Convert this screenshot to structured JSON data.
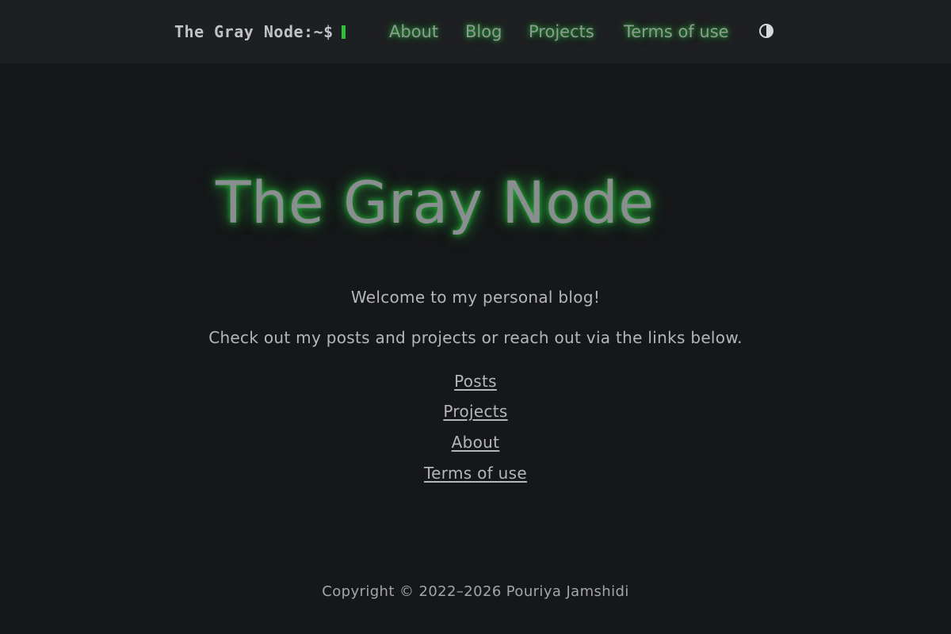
{
  "header": {
    "brand": "The Gray Node:~$",
    "nav": {
      "about": "About",
      "blog": "Blog",
      "projects": "Projects",
      "terms": "Terms of use"
    },
    "theme_toggle_icon": "contrast-half-circle-icon"
  },
  "main": {
    "title": "The Gray Node",
    "welcome": "Welcome to my personal blog!",
    "intro": "Check out my posts and projects or reach out via the links below.",
    "links": {
      "posts": "Posts",
      "projects": "Projects",
      "about": "About",
      "terms": "Terms of use"
    }
  },
  "footer": {
    "copyright": "Copyright © 2022–2026 Pouriya Jamshidi"
  },
  "colors": {
    "background": "#16171a",
    "header_background": "#1e1f22",
    "glow_green": "#28be3c",
    "cursor_green": "#2fbf3a",
    "text": "#b4b6b9"
  }
}
